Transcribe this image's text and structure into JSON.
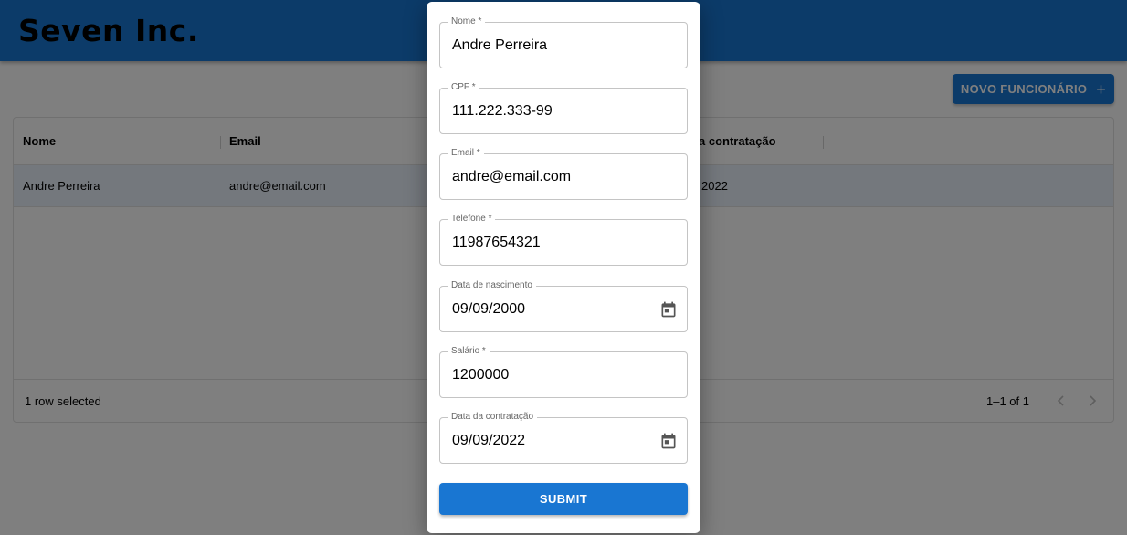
{
  "app": {
    "brand": "Seven Inc."
  },
  "toolbar": {
    "add_label": "NOVO FUNCIONÁRIO",
    "add_icon": "plus-icon"
  },
  "grid": {
    "columns": [
      "Nome",
      "Email",
      "a contratação"
    ],
    "rows": [
      {
        "nome": "Andre Perreira",
        "email": "andre@email.com",
        "contratacao": "2022"
      }
    ],
    "footer": {
      "selected": "1 row selected",
      "pagination": "1–1 of 1"
    }
  },
  "form": {
    "fields": [
      {
        "label": "Nome *",
        "value": "Andre Perreira"
      },
      {
        "label": "CPF *",
        "value": "111.222.333-99"
      },
      {
        "label": "Email *",
        "value": "andre@email.com"
      },
      {
        "label": "Telefone *",
        "value": "11987654321"
      },
      {
        "label": "Data de nascimento",
        "value": "09/09/2000",
        "icon": "calendar-icon"
      },
      {
        "label": "Salário *",
        "value": "1200000"
      },
      {
        "label": "Data da contratação",
        "value": "09/09/2022",
        "icon": "calendar-icon"
      }
    ],
    "submit_label": "SUBMIT"
  },
  "colors": {
    "primary": "#1976d2",
    "selected_row": "#e8f0fb"
  }
}
